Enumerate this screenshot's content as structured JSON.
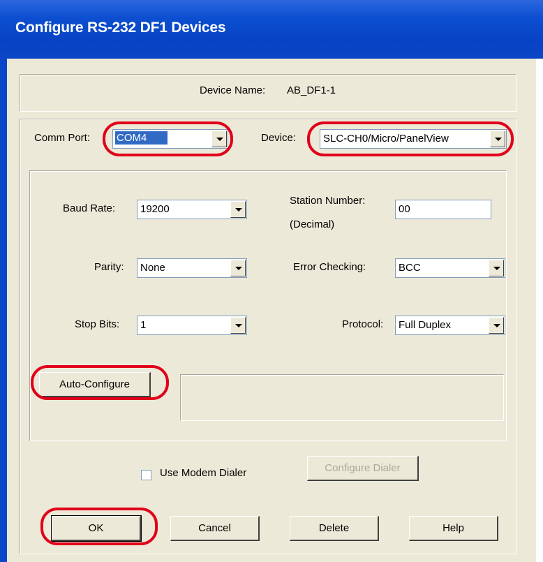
{
  "window": {
    "title": "Configure RS-232 DF1 Devices"
  },
  "device_name": {
    "label": "Device Name:",
    "value": "AB_DF1-1"
  },
  "comm_port": {
    "label": "Comm Port:",
    "value": "COM4"
  },
  "device": {
    "label": "Device:",
    "value": "SLC-CH0/Micro/PanelView"
  },
  "baud_rate": {
    "label": "Baud Rate:",
    "value": "19200"
  },
  "station_number": {
    "label_line1": "Station Number:",
    "label_line2": "(Decimal)",
    "value": "00"
  },
  "parity": {
    "label": "Parity:",
    "value": "None"
  },
  "error_checking": {
    "label": "Error Checking:",
    "value": "BCC"
  },
  "stop_bits": {
    "label": "Stop Bits:",
    "value": "1"
  },
  "protocol": {
    "label": "Protocol:",
    "value": "Full Duplex"
  },
  "auto_configure": {
    "label": "Auto-Configure"
  },
  "modem": {
    "checkbox_label": "Use Modem Dialer",
    "checked": false,
    "configure_label": "Configure Dialer"
  },
  "buttons": {
    "ok": "OK",
    "cancel": "Cancel",
    "delete": "Delete",
    "help": "Help"
  },
  "colors": {
    "titlebar": "#0a47c8",
    "dialog": "#ece9d8",
    "highlight": "#e1001a",
    "selection": "#316ac5"
  }
}
